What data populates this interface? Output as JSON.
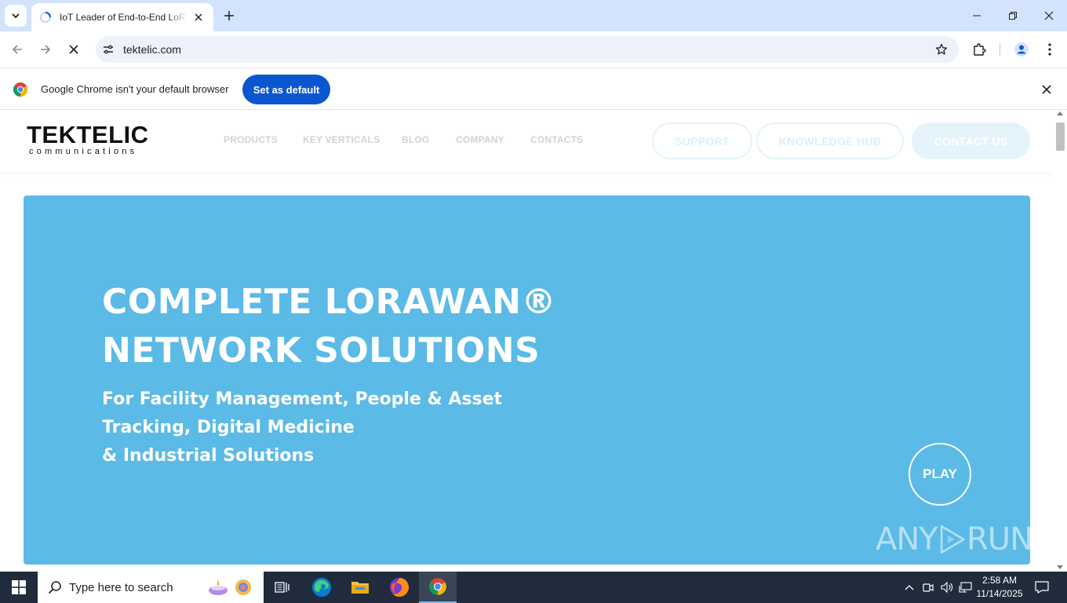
{
  "browser": {
    "tab": {
      "title": "IoT Leader of End-to-End LoRaWAN"
    },
    "address": {
      "url": "tektelic.com"
    },
    "infobar": {
      "message": "Google Chrome isn't your default browser",
      "button": "Set as default"
    }
  },
  "site": {
    "logo": {
      "main": "TEKTELIC",
      "sub": "communications"
    },
    "nav": [
      "PRODUCTS",
      "KEY VERTICALS",
      "BLOG",
      "COMPANY",
      "CONTACTS"
    ],
    "buttons": {
      "support": "SUPPORT",
      "knowledge": "KNOWLEDGE HUB",
      "contact": "CONTACT US"
    },
    "hero": {
      "title_line1": "COMPLETE LORAWAN®",
      "title_line2": "NETWORK SOLUTIONS",
      "sub_line1": "For Facility Management, People & Asset",
      "sub_line2": "Tracking, Digital Medicine",
      "sub_line3": "& Industrial Solutions",
      "play": "PLAY",
      "hero_color": "#5bbae6"
    },
    "watermark": {
      "left": "ANY",
      "right": "RUN"
    }
  },
  "taskbar": {
    "search_placeholder": "Type here to search",
    "time": "2:58 AM",
    "date": "11/14/2025"
  },
  "colors": {
    "accent": "#0b57d0",
    "tabstrip": "#d3e3fd",
    "taskbar": "#202c3c"
  }
}
